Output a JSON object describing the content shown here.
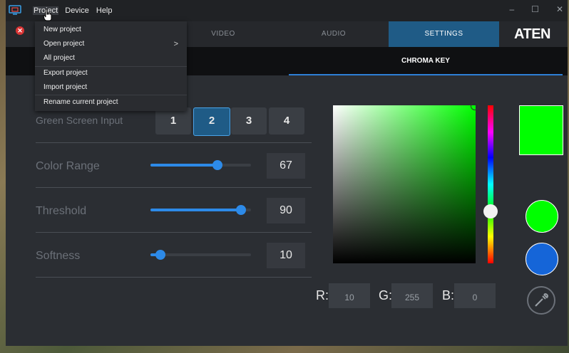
{
  "menubar": {
    "items": [
      "Project",
      "Device",
      "Help"
    ]
  },
  "window_controls": [
    "–",
    "☐",
    "✕"
  ],
  "tabs": [
    {
      "label": "VIDEO"
    },
    {
      "label": "AUDIO"
    },
    {
      "label": "SETTINGS",
      "active": true
    }
  ],
  "brand": {
    "logo": "ATEN"
  },
  "subtab": {
    "label": "CHROMA KEY"
  },
  "project_menu": {
    "items": [
      {
        "label": "New project"
      },
      {
        "label": "Open project",
        "submenu": ">"
      },
      {
        "label": "All project"
      },
      {
        "label": "Export project"
      },
      {
        "label": "Import project"
      },
      {
        "label": "Rename current project"
      }
    ]
  },
  "chroma": {
    "green_screen_input": {
      "label": "Green Screen Input",
      "options": [
        "1",
        "2",
        "3",
        "4"
      ],
      "selected": "2"
    },
    "color_range": {
      "label": "Color Range",
      "value": "67",
      "fraction": 0.67
    },
    "threshold": {
      "label": "Threshold",
      "value": "90",
      "fraction": 0.9
    },
    "softness": {
      "label": "Softness",
      "value": "10",
      "fraction": 0.1
    }
  },
  "color": {
    "r_label": "R:",
    "g_label": "G:",
    "b_label": "B:",
    "r": "10",
    "g": "255",
    "b": "0",
    "preview_hex": "#00ff00",
    "swatch_green": "#00ff00",
    "swatch_blue": "#1565d8"
  },
  "icons": {
    "app": "app-monitor-icon",
    "eyedropper": "eyedropper-icon",
    "close_badge": "close-icon"
  }
}
